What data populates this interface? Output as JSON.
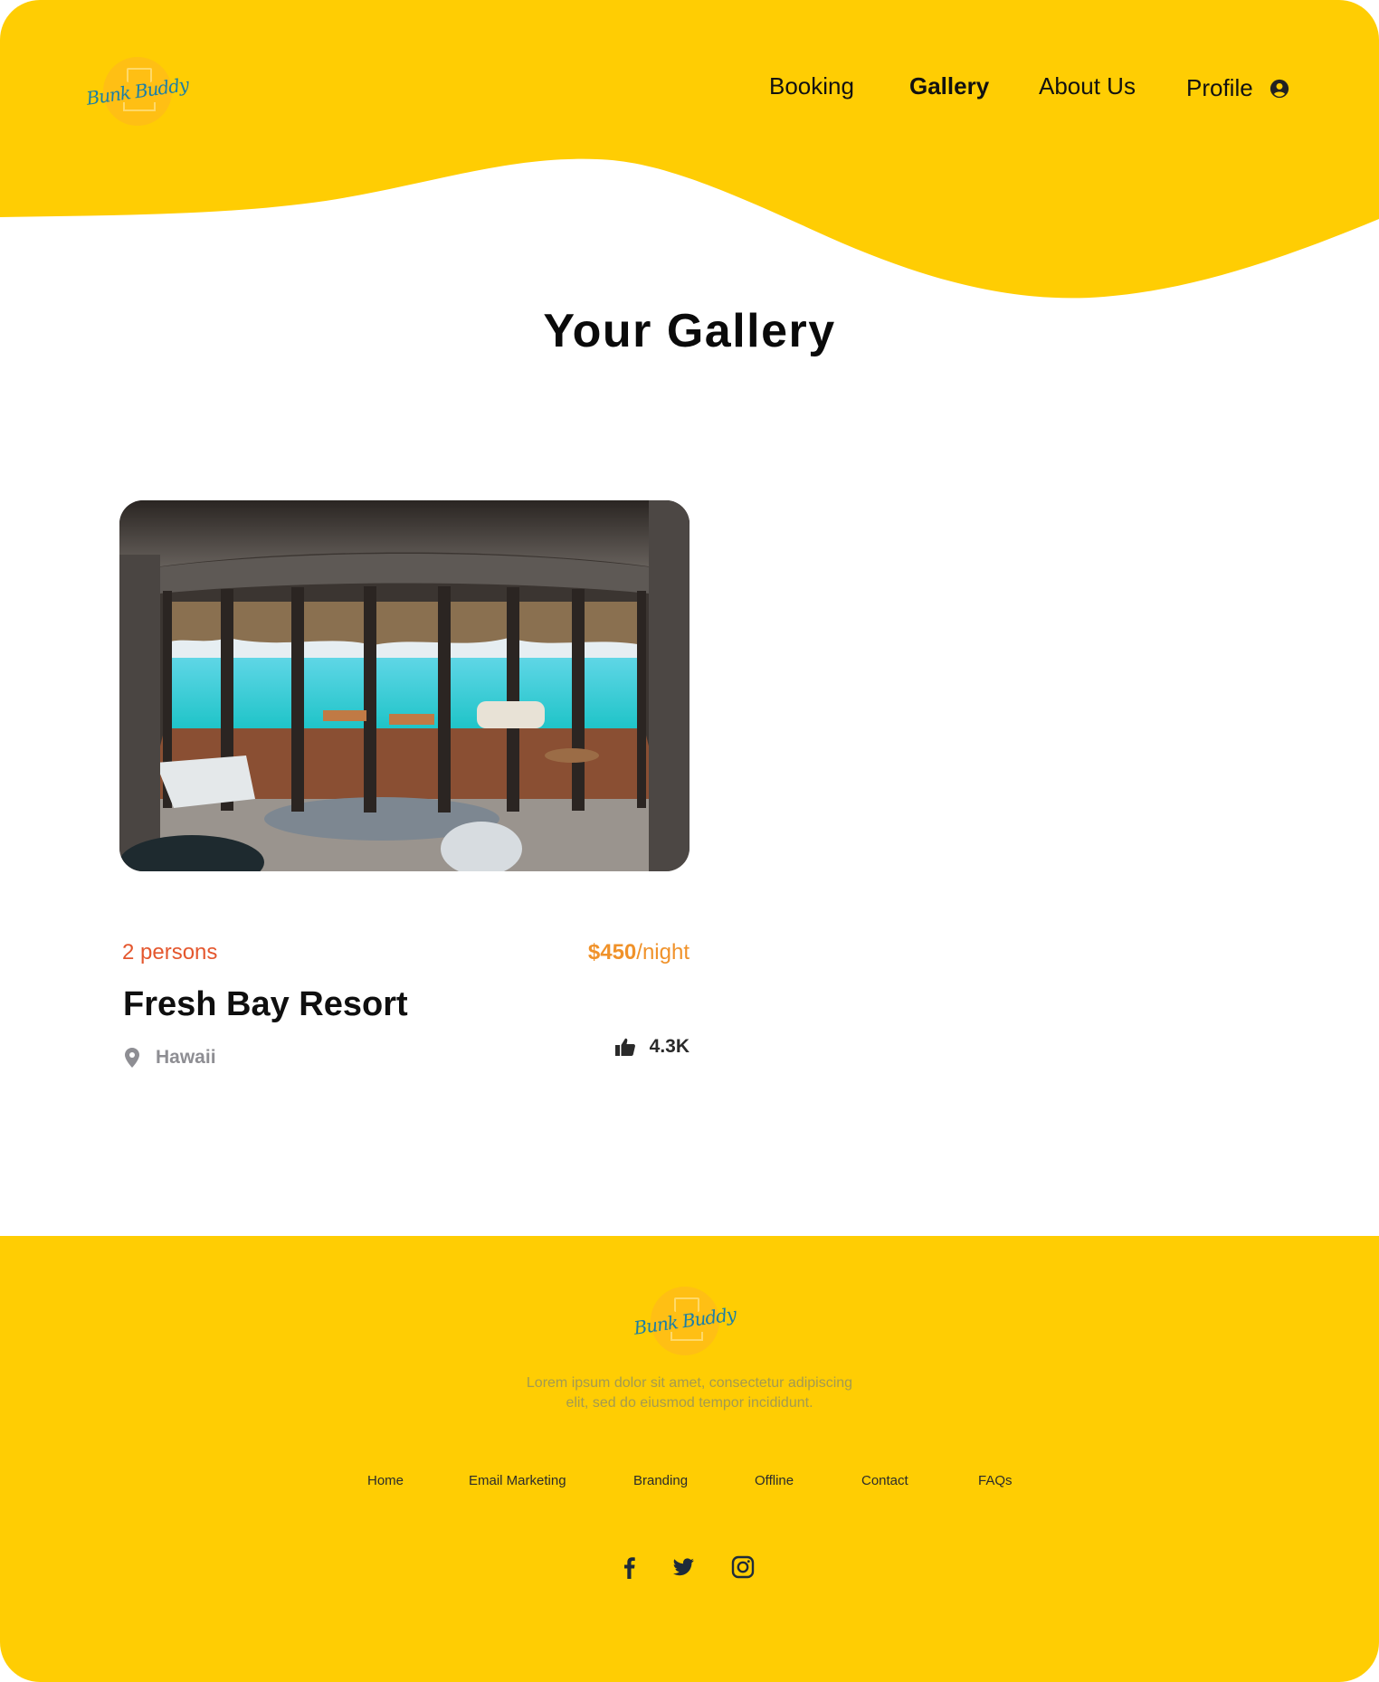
{
  "header": {
    "logo_text": "Bunk Buddy",
    "nav": {
      "booking": "Booking",
      "gallery": "Gallery",
      "about": "About Us",
      "profile": "Profile"
    }
  },
  "main": {
    "title": "Your Gallery",
    "cards": [
      {
        "persons": "2 persons",
        "price_amount": "$450",
        "price_unit": "/night",
        "name": "Fresh Bay Resort",
        "location": "Hawaii",
        "likes": "4.3K"
      }
    ]
  },
  "footer": {
    "logo_text": "Bunk Buddy",
    "description_line1": "Lorem ipsum dolor sit amet, consectetur adipiscing",
    "description_line2": "elit, sed do eiusmod tempor incididunt.",
    "links": [
      "Home",
      "Email Marketing",
      "Branding",
      "Offline",
      "Contact",
      "FAQs"
    ],
    "socials": [
      "facebook-icon",
      "twitter-icon",
      "instagram-icon"
    ]
  },
  "colors": {
    "brand_yellow": "#ffcd03",
    "persons_red": "#e4572e",
    "price_orange": "#f0922a",
    "muted_gray": "#8e8e93"
  }
}
